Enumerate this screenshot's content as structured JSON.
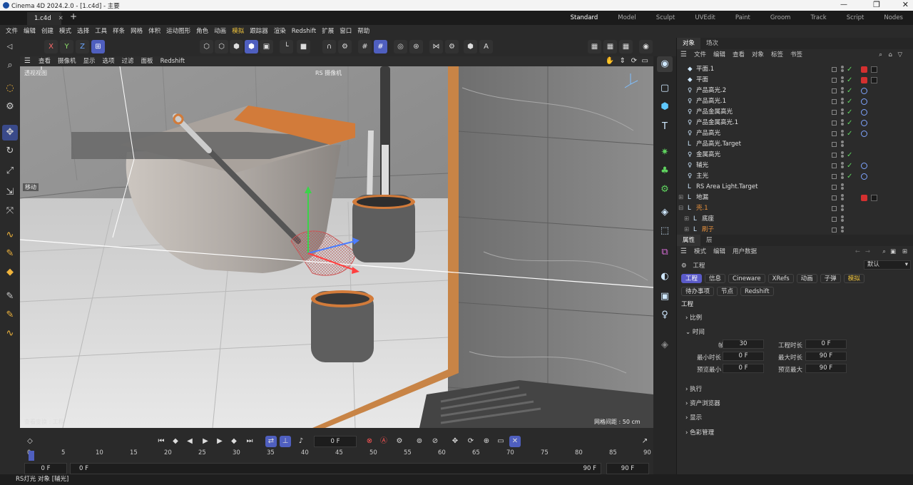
{
  "window": {
    "title": "Cinema 4D 2024.2.0 - [1.c4d] - 主要",
    "file_tab": "1.c4d"
  },
  "layouts": [
    "Standard",
    "Model",
    "Sculpt",
    "UVEdit",
    "Paint",
    "Groom",
    "Track",
    "Script",
    "Nodes"
  ],
  "menus": [
    "文件",
    "编辑",
    "创建",
    "模式",
    "选择",
    "工具",
    "样条",
    "网格",
    "体积",
    "运动图形",
    "角色",
    "动画",
    "模拟",
    "跟踪器",
    "渲染",
    "Redshift",
    "扩展",
    "窗口",
    "帮助"
  ],
  "axis_toggles": [
    "X",
    "Y",
    "Z"
  ],
  "viewport": {
    "menu": [
      "查看",
      "摄像机",
      "显示",
      "选项",
      "过滤",
      "面板",
      "Redshift"
    ],
    "view_name": "透视视图",
    "camera": "RS 摄像机",
    "tool_label": "移动",
    "grid_spacing": "网格间距 : 50 cm",
    "bottom_left": "查看变换 : 工程"
  },
  "timeline": {
    "current_frame": "0 F",
    "ticks": [
      "0",
      "5",
      "10",
      "15",
      "20",
      "25",
      "30",
      "35",
      "40",
      "45",
      "50",
      "55",
      "60",
      "65",
      "70",
      "75",
      "80",
      "85",
      "90"
    ],
    "start": "0 F",
    "preview_start": "0 F",
    "preview_end": "90 F",
    "end": "90 F"
  },
  "status": "RS灯光 对象 [辅光]",
  "object_manager": {
    "tabs": [
      "对象",
      "场次"
    ],
    "menu": [
      "文件",
      "编辑",
      "查看",
      "对象",
      "标签",
      "书签"
    ],
    "items": [
      {
        "name": "平面.1",
        "icon": "◆",
        "exp": "",
        "check": true,
        "tag": "material"
      },
      {
        "name": "平面",
        "icon": "◆",
        "exp": "",
        "check": true,
        "tag": "material"
      },
      {
        "name": "产品高光.2",
        "icon": "♀",
        "exp": "",
        "check": true,
        "tag": "target"
      },
      {
        "name": "产品高光.1",
        "icon": "♀",
        "exp": "",
        "check": true,
        "tag": "target"
      },
      {
        "name": "产品金属高光",
        "icon": "♀",
        "exp": "",
        "check": true,
        "tag": "target"
      },
      {
        "name": "产品金属高光.1",
        "icon": "♀",
        "exp": "",
        "check": true,
        "tag": "target"
      },
      {
        "name": "产品高光",
        "icon": "♀",
        "exp": "",
        "check": true,
        "tag": "target"
      },
      {
        "name": "产品高光.Target",
        "icon": "L",
        "exp": "",
        "check": false,
        "tag": ""
      },
      {
        "name": "金属高光",
        "icon": "♀",
        "exp": "",
        "check": true,
        "tag": ""
      },
      {
        "name": "辅光",
        "icon": "♀",
        "exp": "",
        "check": true,
        "tag": "target"
      },
      {
        "name": "主光",
        "icon": "♀",
        "exp": "",
        "check": true,
        "tag": "target"
      },
      {
        "name": "RS Area Light.Target",
        "icon": "L",
        "exp": "",
        "check": false,
        "tag": ""
      },
      {
        "name": "地漏",
        "icon": "L",
        "exp": "⊞",
        "check": false,
        "tag": "material"
      },
      {
        "name": "壳.1",
        "icon": "L",
        "exp": "⊟",
        "check": false,
        "tag": "",
        "orange": true
      },
      {
        "name": "底座",
        "icon": "L",
        "exp": "⊞",
        "check": false,
        "tag": "",
        "indent": true
      },
      {
        "name": "刷子",
        "icon": "L",
        "exp": "⊞",
        "check": false,
        "tag": "",
        "indent": true,
        "orange": true
      }
    ]
  },
  "attributes": {
    "tabs": [
      "属性",
      "层"
    ],
    "menu": [
      "模式",
      "编辑",
      "用户数据"
    ],
    "mode": "工程",
    "preset": "默认",
    "tab_row1": [
      "工程",
      "信息",
      "Cineware",
      "XRefs",
      "动画",
      "子弹",
      "模拟"
    ],
    "tab_row2": [
      "待办事项",
      "节点",
      "Redshift"
    ],
    "section_title": "工程",
    "groups": [
      "比例",
      "时间",
      "执行",
      "资产浏览器",
      "显示",
      "色彩管理"
    ],
    "fields": {
      "fps_label": "帧率",
      "fps": "30",
      "duration_label": "工程时长",
      "duration": "0 F",
      "min_label": "最小时长",
      "min": "0 F",
      "max_label": "最大时长",
      "max": "90 F",
      "pmin_label": "预览最小",
      "pmin": "0 F",
      "pmax_label": "预览最大",
      "pmax": "90 F"
    }
  }
}
